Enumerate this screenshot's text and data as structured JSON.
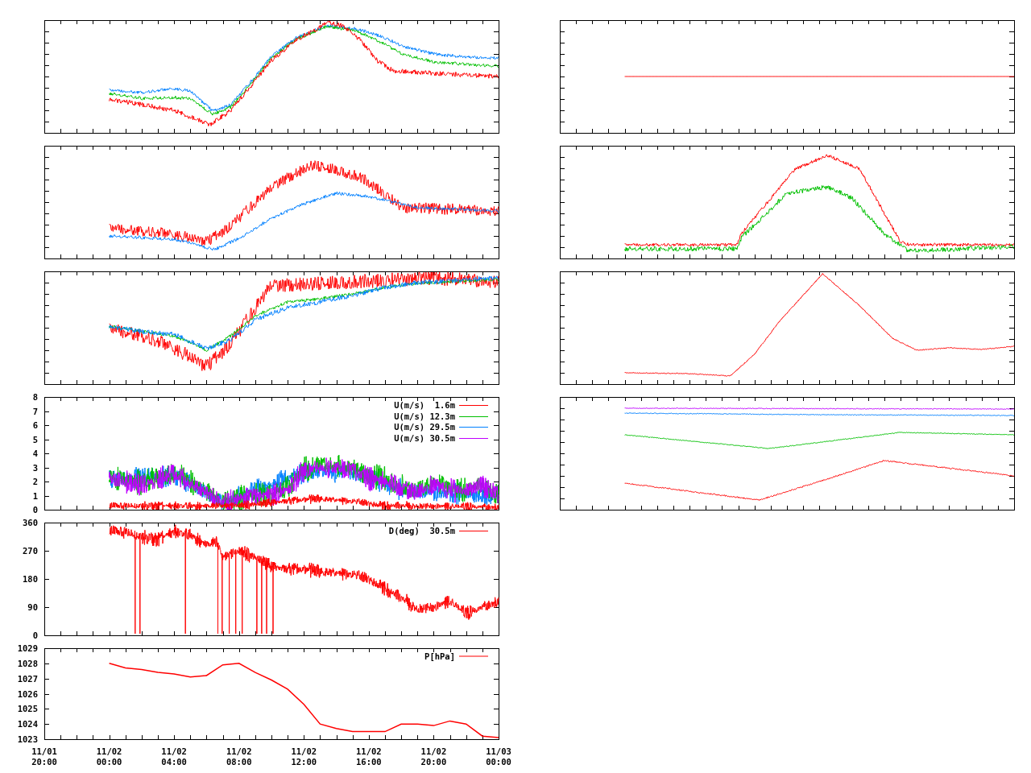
{
  "left_column": [
    {
      "kind": "trace_plot"
    },
    {
      "kind": "trace_plot"
    },
    {
      "kind": "trace_plot"
    },
    {
      "kind": "labeled_plot",
      "y_tick_labels": [
        "8",
        "7",
        "6",
        "5",
        "4",
        "3",
        "2",
        "1",
        "0"
      ],
      "legend": [
        {
          "label": "U(m/s)  1.6m",
          "color": "#ff0000"
        },
        {
          "label": "U(m/s) 12.3m",
          "color": "#00c000"
        },
        {
          "label": "U(m/s) 29.5m",
          "color": "#0080ff"
        },
        {
          "label": "U(m/s) 30.5m",
          "color": "#c000ff"
        }
      ]
    },
    {
      "kind": "labeled_plot",
      "y_tick_labels": [
        "360",
        "270",
        "180",
        "90",
        "0"
      ],
      "legend": [
        {
          "label": "D(deg)  30.5m",
          "color": "#ff0000"
        }
      ]
    },
    {
      "kind": "chart",
      "chart_data": {
        "type": "line",
        "categories": [
          "11/01 20:00",
          null,
          null,
          null,
          "11/02 00:00",
          null,
          null,
          null,
          "11/02 04:00",
          null,
          null,
          null,
          "11/02 08:00",
          null,
          null,
          null,
          "11/02 12:00",
          null,
          null,
          null,
          "11/02 16:00",
          null,
          null,
          null,
          "11/02 20:00",
          null,
          null,
          null,
          "11/03 00:00"
        ],
        "ylim": [
          1023,
          1029
        ],
        "yticks": [
          1023,
          1024,
          1025,
          1026,
          1027,
          1028,
          1029
        ],
        "series": [
          {
            "name": "P[hPa]",
            "color": "#ff0000",
            "values": [
              null,
              null,
              null,
              null,
              1028,
              1027.7,
              1027.6,
              1027.4,
              1027.3,
              1027.1,
              1027.2,
              1027.9,
              1028,
              1027.4,
              1026.9,
              1026.3,
              1025.3,
              1024,
              1023.7,
              1023.5,
              1023.5,
              1023.5,
              1024,
              1024,
              1023.9,
              1024.2,
              1024,
              1023.2,
              1023.1
            ]
          }
        ]
      }
    }
  ],
  "right_column": [
    {
      "kind": "trace_plot"
    },
    {
      "kind": "trace_plot"
    },
    {
      "kind": "trace_plot"
    },
    {
      "kind": "trace_plot"
    }
  ]
}
